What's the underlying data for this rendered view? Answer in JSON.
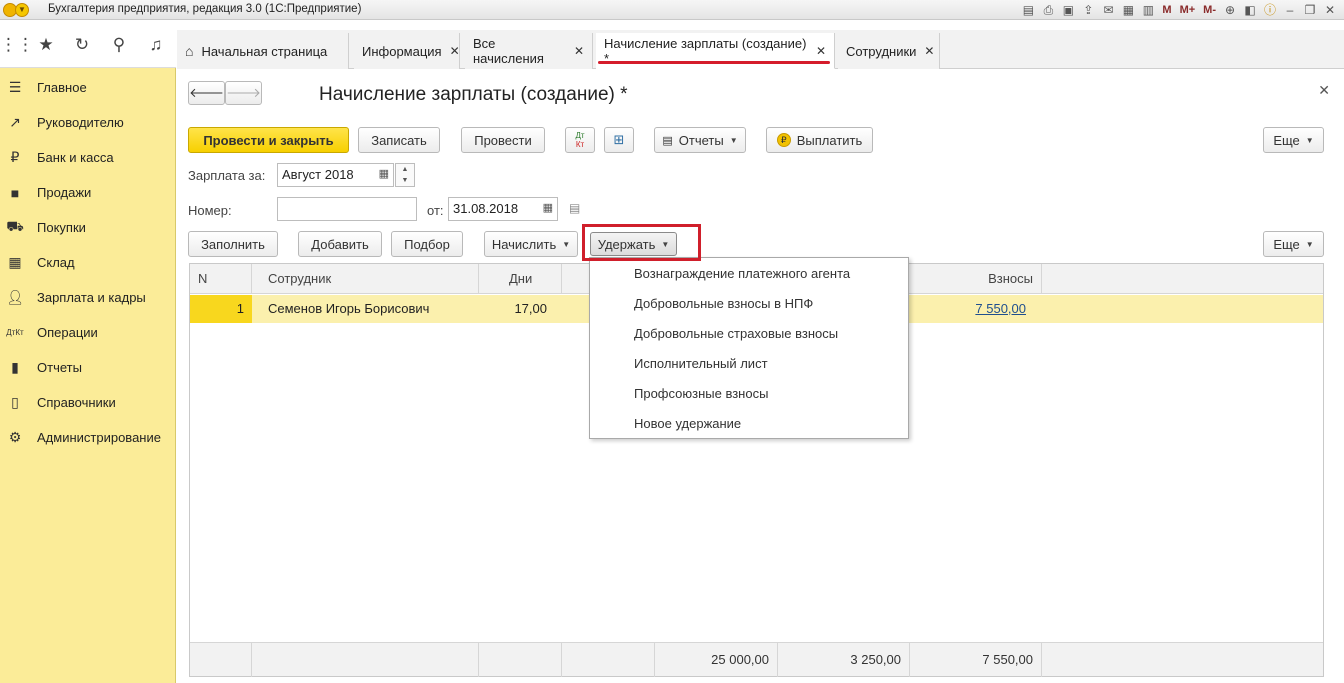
{
  "window": {
    "title": "Бухгалтерия предприятия, редакция 3.0  (1С:Предприятие)",
    "toolbar_icons": [
      "save-icon",
      "print-icon",
      "preview-icon",
      "export-icon",
      "mail-icon",
      "calculator-icon",
      "calendar-icon",
      "zoom-icon",
      "panel-icon",
      "info-icon",
      "minimize-icon",
      "restore-icon"
    ],
    "memory_buttons": [
      "M",
      "M+",
      "M-"
    ]
  },
  "sidebar": {
    "items": [
      {
        "label": "Главное",
        "icon": "menu-icon"
      },
      {
        "label": "Руководителю",
        "icon": "trend-icon"
      },
      {
        "label": "Банк и касса",
        "icon": "ruble-icon"
      },
      {
        "label": "Продажи",
        "icon": "bag-icon"
      },
      {
        "label": "Покупки",
        "icon": "cart-icon"
      },
      {
        "label": "Склад",
        "icon": "warehouse-icon"
      },
      {
        "label": "Зарплата и кадры",
        "icon": "person-icon"
      },
      {
        "label": "Операции",
        "icon": "dt-kt-icon"
      },
      {
        "label": "Отчеты",
        "icon": "bar-chart-icon"
      },
      {
        "label": "Справочники",
        "icon": "book-icon"
      },
      {
        "label": "Администрирование",
        "icon": "gear-icon"
      }
    ]
  },
  "tabs": [
    {
      "label": "Начальная страница"
    },
    {
      "label": "Информация"
    },
    {
      "label": "Все начисления"
    },
    {
      "label": "Начисление зарплаты (создание) *"
    },
    {
      "label": "Сотрудники"
    }
  ],
  "form": {
    "title": "Начисление зарплаты (создание) *",
    "toolbar": {
      "post_close": "Провести и закрыть",
      "save": "Записать",
      "post": "Провести",
      "dt_kt": "Дт Кт",
      "reports": "Отчеты",
      "pay": "Выплатить",
      "more": "Еще"
    },
    "salary_for_label": "Зарплата за:",
    "salary_for_value": "Август 2018",
    "number_label": "Номер:",
    "number_value": "",
    "date_label": "от:",
    "date_value": "31.08.2018",
    "table_toolbar": {
      "fill": "Заполнить",
      "add": "Добавить",
      "pick": "Подбор",
      "accrue": "Начислить",
      "withhold": "Удержать",
      "more": "Еще"
    }
  },
  "table": {
    "columns": [
      "N",
      "Сотрудник",
      "Дни",
      "Взносы"
    ],
    "rows": [
      {
        "n": "1",
        "employee": "Семенов Игорь Борисович",
        "days": "17,00",
        "contributions": "7 550,00"
      }
    ],
    "totals": {
      "accrued": "25 000,00",
      "ndfl": "3 250,00",
      "contributions": "7 550,00"
    }
  },
  "withhold_menu": {
    "items": [
      "Вознаграждение платежного агента",
      "Добровольные взносы в НПФ",
      "Добровольные страховые взносы",
      "Исполнительный лист",
      "Профсоюзные взносы",
      "Новое удержание"
    ]
  },
  "colors": {
    "sidebar_bg": "#fbec98",
    "primary_button": "#f7d000",
    "highlight_red": "#d01f2b",
    "selected_row": "#fbf0ad"
  }
}
